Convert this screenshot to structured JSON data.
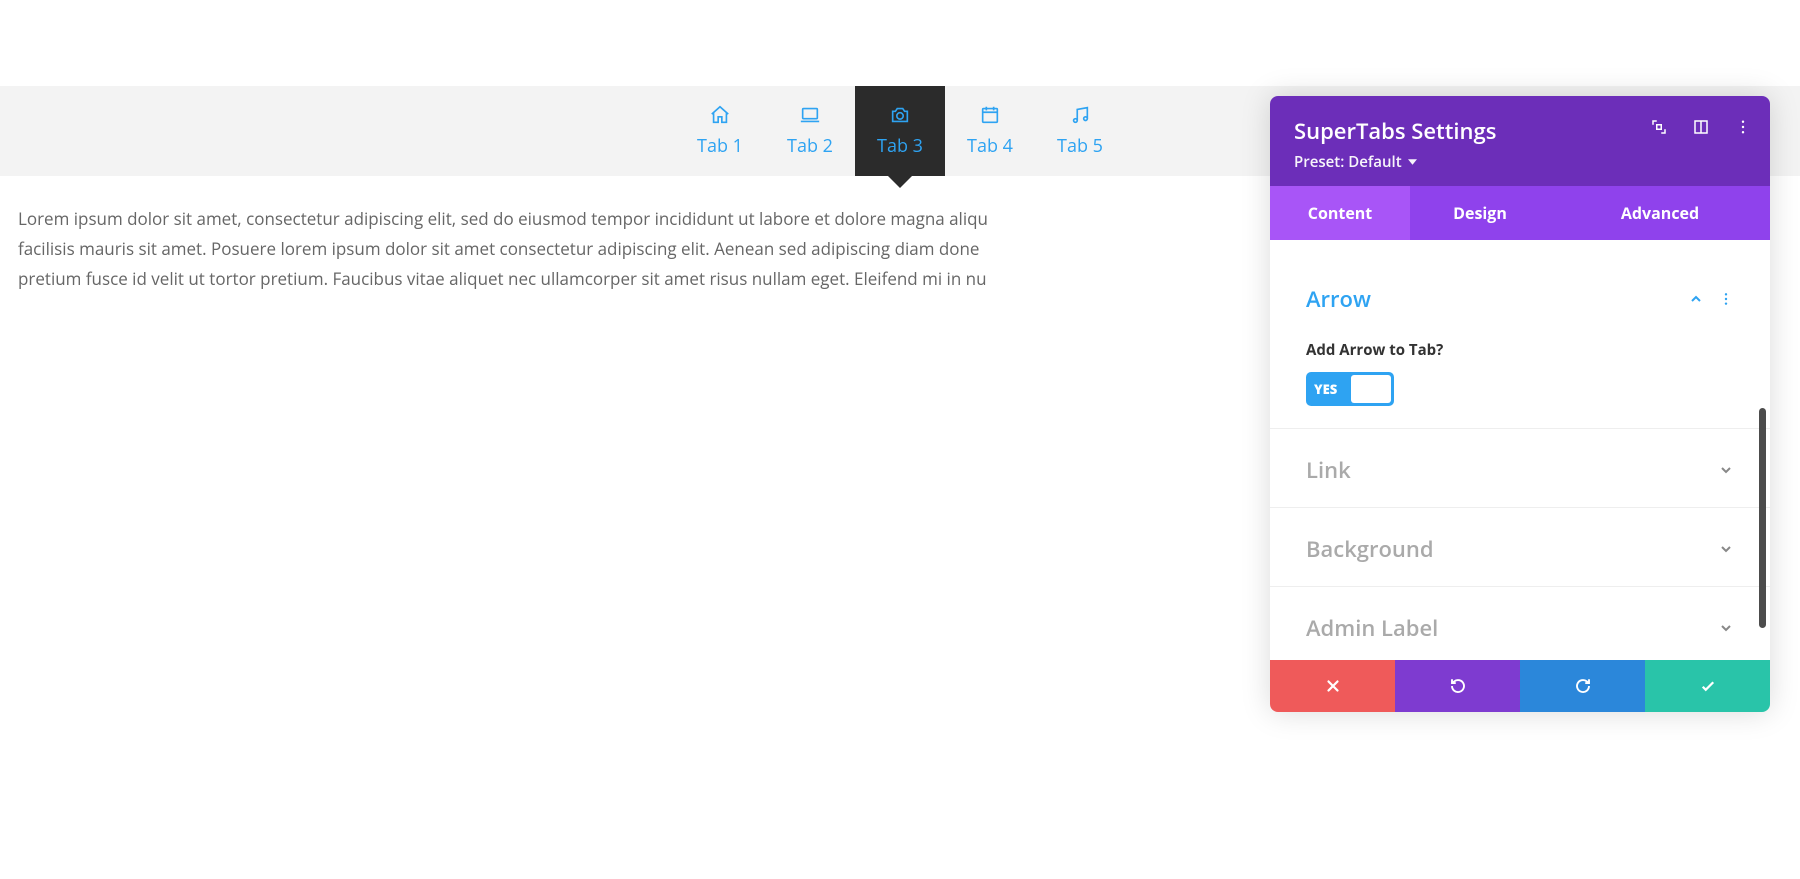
{
  "tabs": {
    "items": [
      {
        "label": "Tab 1",
        "icon": "home-icon"
      },
      {
        "label": "Tab 2",
        "icon": "laptop-icon"
      },
      {
        "label": "Tab 3",
        "icon": "camera-icon"
      },
      {
        "label": "Tab 4",
        "icon": "calendar-icon"
      },
      {
        "label": "Tab 5",
        "icon": "music-icon"
      }
    ],
    "active_index": 2
  },
  "content": {
    "paragraph": "Lorem ipsum dolor sit amet, consectetur adipiscing elit, sed do eiusmod tempor incididunt ut labore et dolore magna aliqu facilisis mauris sit amet. Posuere lorem ipsum dolor sit amet consectetur adipiscing elit. Aenean sed adipiscing diam done pretium fusce id velit ut tortor pretium. Faucibus vitae aliquet nec ullamcorper sit amet risus nullam eget. Eleifend mi in nu"
  },
  "panel": {
    "title": "SuperTabs Settings",
    "preset_label": "Preset: Default",
    "tabs": {
      "content": "Content",
      "design": "Design",
      "advanced": "Advanced",
      "active": "content"
    },
    "sections": {
      "arrow": {
        "title": "Arrow",
        "open": true,
        "field_label": "Add Arrow to Tab?",
        "toggle_value": "YES"
      },
      "link": {
        "title": "Link"
      },
      "background": {
        "title": "Background"
      },
      "admin_label": {
        "title": "Admin Label"
      }
    }
  },
  "colors": {
    "accent_blue": "#2ea3f2",
    "panel_purple_dark": "#6c2eb9",
    "panel_purple": "#8f42ec",
    "panel_purple_light": "#a855f7",
    "footer_red": "#ef5a5a",
    "footer_blue": "#2b87da",
    "footer_green": "#29c4a9"
  }
}
